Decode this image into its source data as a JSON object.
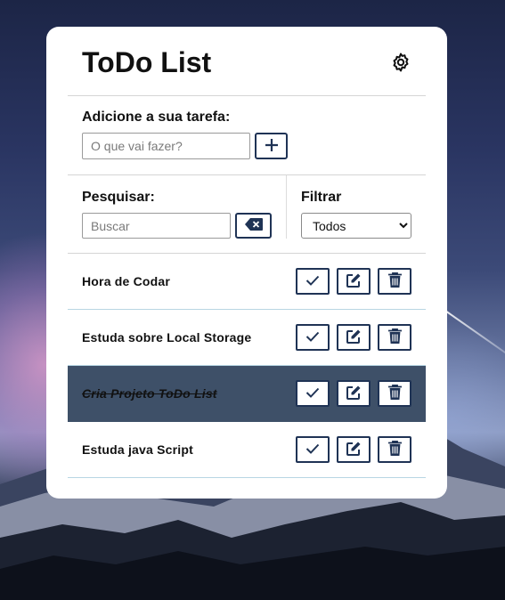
{
  "app": {
    "title": "ToDo List"
  },
  "add": {
    "label": "Adicione a sua tarefa:",
    "placeholder": "O que vai fazer?",
    "value": ""
  },
  "search": {
    "label": "Pesquisar:",
    "placeholder": "Buscar",
    "value": ""
  },
  "filter": {
    "label": "Filtrar",
    "selected": "Todos"
  },
  "todos": [
    {
      "text": "Hora de Codar",
      "done": false
    },
    {
      "text": "Estuda sobre Local Storage",
      "done": false
    },
    {
      "text": "Cria Projeto ToDo List",
      "done": true
    },
    {
      "text": "Estuda java Script",
      "done": false
    }
  ],
  "icons": {
    "settings": "gear-icon",
    "add": "plus-icon",
    "clear": "backspace-icon",
    "done": "check-icon",
    "edit": "edit-icon",
    "delete": "trash-icon"
  },
  "colors": {
    "accent": "#1f3355",
    "done_row": "#3e5068",
    "divider": "#b8d6e3"
  }
}
